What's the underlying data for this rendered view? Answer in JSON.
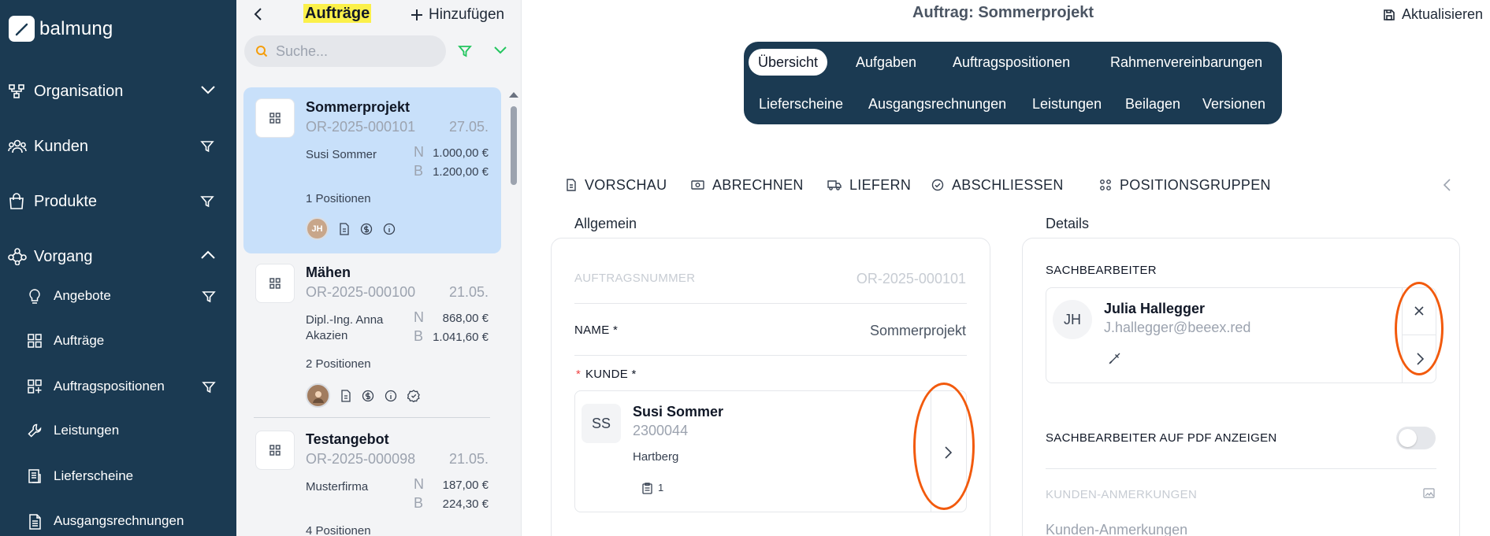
{
  "sidebar": {
    "logo": "balmung",
    "items": [
      {
        "label": "Organisation"
      },
      {
        "label": "Kunden"
      },
      {
        "label": "Produkte"
      },
      {
        "label": "Vorgang"
      }
    ],
    "sub_items": [
      {
        "label": "Angebote"
      },
      {
        "label": "Aufträge"
      },
      {
        "label": "Auftragspositionen"
      },
      {
        "label": "Leistungen"
      },
      {
        "label": "Lieferscheine"
      },
      {
        "label": "Ausgangsrechnungen"
      }
    ]
  },
  "list": {
    "title": "Aufträge",
    "add_label": "Hinzufügen",
    "search_placeholder": "Suche...",
    "cards": [
      {
        "title": "Sommerprojekt",
        "number": "OR-2025-000101",
        "date": "27.05.",
        "customer": "Susi Sommer",
        "net_label": "N",
        "net": "1.000,00 €",
        "gross_label": "B",
        "gross": "1.200,00 €",
        "positions": "1 Positionen",
        "avatar": "JH"
      },
      {
        "title": "Mähen",
        "number": "OR-2025-000100",
        "date": "21.05.",
        "customer": "Dipl.-Ing. Anna Akazien",
        "net_label": "N",
        "net": "868,00 €",
        "gross_label": "B",
        "gross": "1.041,60 €",
        "positions": "2 Positionen"
      },
      {
        "title": "Testangebot",
        "number": "OR-2025-000098",
        "date": "21.05.",
        "customer": "Musterfirma",
        "net_label": "N",
        "net": "187,00 €",
        "gross_label": "B",
        "gross": "224,30 €",
        "positions": "4 Positionen"
      }
    ]
  },
  "main": {
    "title": "Auftrag: Sommerprojekt",
    "refresh_label": "Aktualisieren",
    "tabs": [
      {
        "label": "Übersicht"
      },
      {
        "label": "Aufgaben"
      },
      {
        "label": "Auftragspositionen"
      },
      {
        "label": "Rahmenvereinbarungen"
      },
      {
        "label": "Lieferscheine"
      },
      {
        "label": "Ausgangsrechnungen"
      },
      {
        "label": "Leistungen"
      },
      {
        "label": "Beilagen"
      },
      {
        "label": "Versionen"
      }
    ],
    "actions": [
      {
        "label": "VORSCHAU"
      },
      {
        "label": "ABRECHNEN"
      },
      {
        "label": "LIEFERN"
      },
      {
        "label": "ABSCHLIESSEN"
      },
      {
        "label": "POSITIONSGRUPPEN"
      }
    ],
    "general": {
      "title": "Allgemein",
      "order_number_label": "AUFTRAGSNUMMER",
      "order_number_value": "OR-2025-000101",
      "name_label": "NAME *",
      "name_value": "Sommerprojekt",
      "required_mark": "*",
      "customer_label": "KUNDE *",
      "customer": {
        "initials": "SS",
        "name": "Susi Sommer",
        "number": "2300044",
        "city": "Hartberg",
        "count": "1"
      }
    },
    "details": {
      "title": "Details",
      "clerk_label": "SACHBEARBEITER",
      "clerk": {
        "initials": "JH",
        "name": "Julia Hallegger",
        "email": "J.hallegger@beeex.red"
      },
      "show_on_pdf_label": "SACHBEARBEITER AUF PDF ANZEIGEN",
      "customer_notes_label": "KUNDEN-ANMERKUNGEN",
      "customer_notes_placeholder": "Kunden-Anmerkungen"
    }
  },
  "colors": {
    "sidebar": "#1b3a52",
    "selected_card": "#c8e0fa",
    "highlight": "#fbf04a",
    "annotation": "#f25a0d",
    "filter": "#22c55e"
  }
}
